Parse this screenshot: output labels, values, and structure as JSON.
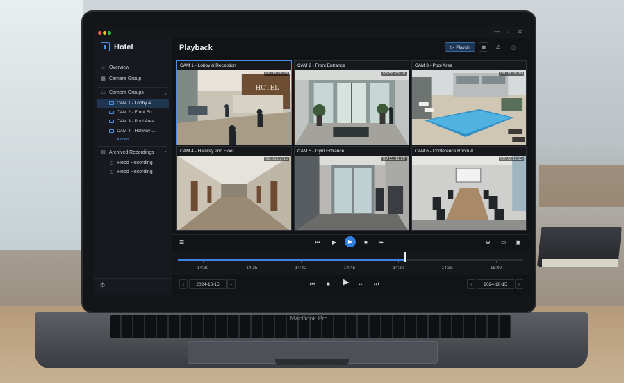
{
  "app": {
    "brand": "Hotel",
    "page_title": "Playback",
    "top_actions": {
      "playback_label": "Playch"
    }
  },
  "sidebar": {
    "overview": "Overview",
    "camera_group": "Camera Group",
    "camera_groups_header": "Camera Groups",
    "cameras": [
      {
        "label": "CAM 1 - Lobby &",
        "active": true
      },
      {
        "label": "CAM 2 - Front En...",
        "active": false
      },
      {
        "label": "CAM 3 - Pool Area",
        "active": false
      },
      {
        "label": "CAM 4 - Hallway ...",
        "active": false
      }
    ],
    "more_link": "Asmen",
    "archived_header": "Archived Recordings",
    "recordings": [
      "Reod Recording",
      "Reod Recording"
    ]
  },
  "cameras": [
    {
      "label": "CAM 1 - Lobby & Reception",
      "time": "09:05:38:26"
    },
    {
      "label": "CAM 2 - Front Entrance",
      "time": "08:58:23:18"
    },
    {
      "label": "CAM 3 - Pool Area",
      "time": "09:05:36:39"
    },
    {
      "label": "CAM 4 - Hallway 2nd Floor",
      "time": "09:06:37:15"
    },
    {
      "label": "CAM 5 - Gym Entrance",
      "time": "09:55:31:29"
    },
    {
      "label": "CAM 6 - Conference Room A",
      "time": "09:06:18:15"
    }
  ],
  "timeline": {
    "labels": [
      "14:30",
      "14:35",
      "14:40",
      "14:45",
      "14:30",
      "14:35",
      "15:00"
    ],
    "progress": 0.66
  },
  "footer": {
    "date_left": "2024-10-15",
    "date_right": "2024-10-15"
  },
  "device": {
    "brand": "MacBook Pro"
  },
  "colors": {
    "accent": "#3b83e0",
    "sidebar_bg": "#17191e",
    "main_bg": "#111317",
    "active_item": "#1f3550"
  }
}
